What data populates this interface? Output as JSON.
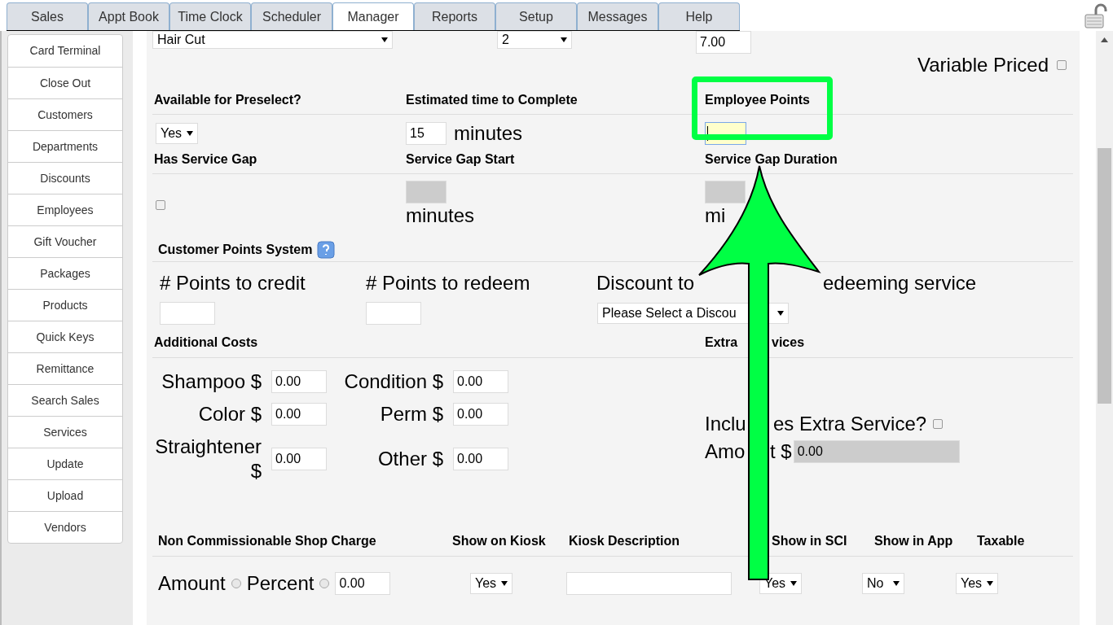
{
  "tabs": [
    {
      "label": "Sales",
      "selected": false
    },
    {
      "label": "Appt Book",
      "selected": false
    },
    {
      "label": "Time Clock",
      "selected": false
    },
    {
      "label": "Scheduler",
      "selected": false
    },
    {
      "label": "Manager",
      "selected": true
    },
    {
      "label": "Reports",
      "selected": false
    },
    {
      "label": "Setup",
      "selected": false
    },
    {
      "label": "Messages",
      "selected": false
    },
    {
      "label": "Help",
      "selected": false
    }
  ],
  "sidebar": {
    "items": [
      "Card Terminal",
      "Close Out",
      "Customers",
      "Departments",
      "Discounts",
      "Employees",
      "Gift Voucher",
      "Packages",
      "Products",
      "Quick Keys",
      "Remittance",
      "Search Sales",
      "Services",
      "Update",
      "Upload",
      "Vendors"
    ]
  },
  "top_row": {
    "service_select": "Hair Cut",
    "level_select": "2",
    "price": "7.00",
    "variable_priced": {
      "label": "Variable Priced",
      "checked": false
    }
  },
  "preselect": {
    "label": "Available for Preselect?",
    "value": "Yes"
  },
  "estimated_time": {
    "label": "Estimated time to Complete",
    "value": "15",
    "unit": "minutes"
  },
  "employee_points": {
    "label": "Employee Points",
    "focused": true
  },
  "service_gap": {
    "label": "Has Service Gap",
    "checked": false,
    "start_label": "Service Gap Start",
    "start_unit": "minutes",
    "duration_label": "Service Gap Duration",
    "duration_unit": "mi"
  },
  "customer_points": {
    "title": "Customer Points System",
    "credit_label": "# Points to credit",
    "redeem_label": "# Points to redeem",
    "discount_label": [
      "Discount to",
      "edeeming service"
    ],
    "discount_select": "Please Select a Discou"
  },
  "additional_costs": {
    "title": "Additional Costs",
    "items": [
      {
        "label": "Shampoo $",
        "value": "0.00"
      },
      {
        "label": "Condition $",
        "value": "0.00"
      },
      {
        "label": "Color $",
        "value": "0.00"
      },
      {
        "label": "Perm $",
        "value": "0.00"
      },
      {
        "label": "Straightener $",
        "value": "0.00"
      },
      {
        "label": "Other $",
        "value": "0.00"
      }
    ]
  },
  "extra_services": {
    "title": [
      "Extra",
      "vices"
    ],
    "includes_label": [
      "Inclu",
      "es Extra Service?"
    ],
    "includes_checked": false,
    "amount_label": [
      "Amo",
      "t $"
    ],
    "amount_value": "0.00"
  },
  "bottom": {
    "columns": [
      "Non Commissionable Shop Charge",
      "Show on Kiosk",
      "Kiosk Description",
      "Show in SCI",
      "Show in App",
      "Taxable"
    ],
    "charge_options": [
      {
        "label": "Amount",
        "selected": false
      },
      {
        "label": "Percent",
        "selected": false
      }
    ],
    "charge_value": "0.00",
    "show_on_kiosk": "Yes",
    "show_in_sci": "Yes",
    "show_in_app": "No",
    "taxable": "Yes"
  }
}
